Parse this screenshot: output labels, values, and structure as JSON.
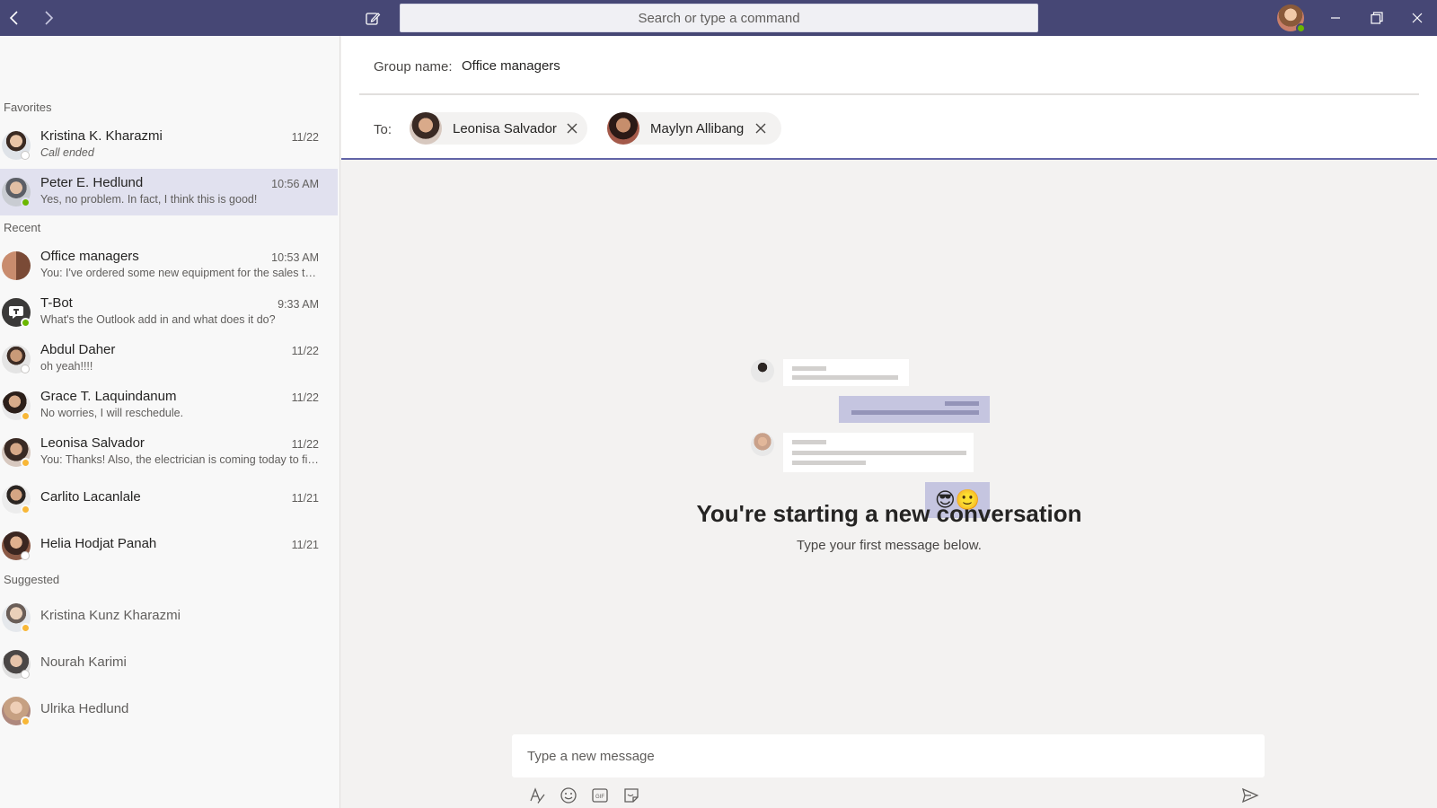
{
  "titlebar": {
    "search_placeholder": "Search or type a command",
    "icons": [
      "back-arrow-icon",
      "forward-arrow-icon",
      "compose-icon",
      "minimize-icon",
      "restore-icon",
      "close-icon"
    ]
  },
  "sidebar": {
    "favorites_header": "Favorites",
    "recent_header": "Recent",
    "suggested_header": "Suggested",
    "favorites": [
      {
        "name": "Kristina K. Kharazmi",
        "time": "11/22",
        "preview": "Call ended",
        "status": "offline"
      },
      {
        "name": "Peter E. Hedlund",
        "time": "10:56 AM",
        "preview": "Yes, no problem. In fact, I think this is good!",
        "status": "available"
      }
    ],
    "recent": [
      {
        "name": "Office managers",
        "time": "10:53 AM",
        "preview": "You: I've ordered some new equipment for the sales team"
      },
      {
        "name": "T-Bot",
        "time": "9:33 AM",
        "preview": "What's the Outlook add in and what does it do?",
        "status": "available"
      },
      {
        "name": "Abdul Daher",
        "time": "11/22",
        "preview": "oh yeah!!!!",
        "status": "offline"
      },
      {
        "name": "Grace T. Laquindanum",
        "time": "11/22",
        "preview": "No worries, I will reschedule.",
        "status": "away"
      },
      {
        "name": "Leonisa Salvador",
        "time": "11/22",
        "preview": "You: Thanks! Also, the electrician is coming today to fix the lights",
        "status": "away"
      },
      {
        "name": "Carlito Lacanlale",
        "time": "11/21",
        "status": "away"
      },
      {
        "name": "Helia Hodjat Panah",
        "time": "11/21",
        "status": "offline"
      }
    ],
    "suggested": [
      {
        "name": "Kristina Kunz Kharazmi",
        "status": "away"
      },
      {
        "name": "Nourah Karimi",
        "status": "offline"
      },
      {
        "name": "Ulrika Hedlund",
        "status": "away"
      }
    ]
  },
  "main": {
    "group_name_label": "Group name:",
    "group_name_value": "Office managers",
    "to_label": "To:",
    "recipients": [
      {
        "name": "Leonisa Salvador"
      },
      {
        "name": "Maylyn Allibang"
      }
    ],
    "empty_title": "You're starting a new conversation",
    "empty_subtitle": "Type your first message below.",
    "illustration_emojis": "😎🙂",
    "compose_placeholder": "Type a new message",
    "compose_tools": [
      "format-icon",
      "emoji-icon",
      "gif-icon",
      "sticker-icon",
      "send-icon"
    ]
  },
  "colors": {
    "titlebar": "#464775",
    "accent": "#6264a7",
    "selected_row": "#e1e1ef",
    "available": "#6bb700",
    "away": "#f8b737"
  }
}
